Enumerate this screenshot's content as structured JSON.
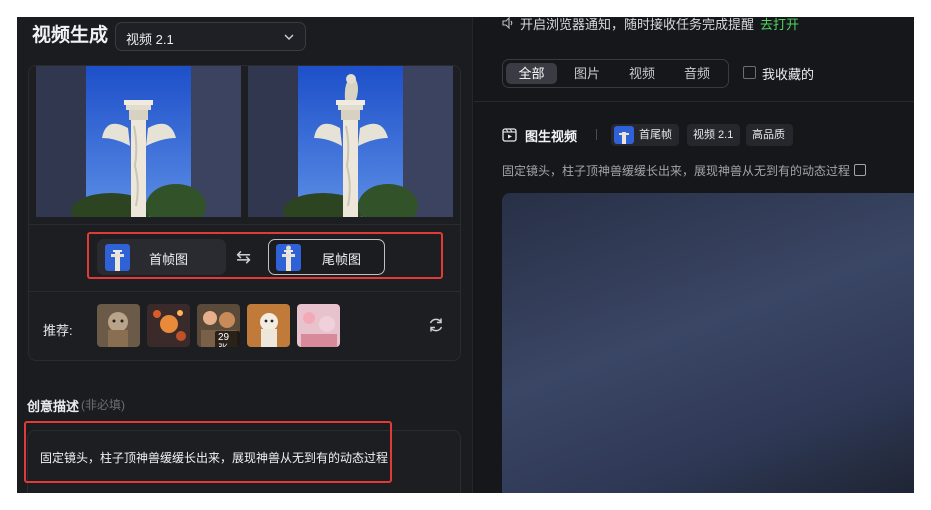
{
  "left_panel": {
    "title": "视频生成",
    "model_select": {
      "value": "视频 2.1"
    },
    "frames": {
      "first_label": "首帧图",
      "last_label": "尾帧图",
      "swap_glyph": "⇆"
    },
    "recommend": {
      "label": "推荐:",
      "count_badge": "29张"
    },
    "description": {
      "title": "创意描述",
      "hint": "(非必填)",
      "value": "固定镜头，柱子顶神兽缓缓长出来，展现神兽从无到有的动态过程"
    }
  },
  "right_panel": {
    "notice": {
      "text": "开启浏览器通知，随时接收任务完成提醒",
      "link": "去打开"
    },
    "filter_tabs": [
      "全部",
      "图片",
      "视频",
      "音频"
    ],
    "favorites_label": "我收藏的",
    "task": {
      "title": "图生视频",
      "tags": [
        "首尾帧",
        "视频 2.1",
        "高品质"
      ],
      "prompt": "固定镜头，柱子顶神兽缓缓长出来，展现神兽从无到有的动态过程"
    }
  },
  "colors": {
    "panel_bg": "#1b1c20",
    "app_bg": "#16171b",
    "link_green": "#4fd461",
    "highlight_red": "#e23a36"
  }
}
